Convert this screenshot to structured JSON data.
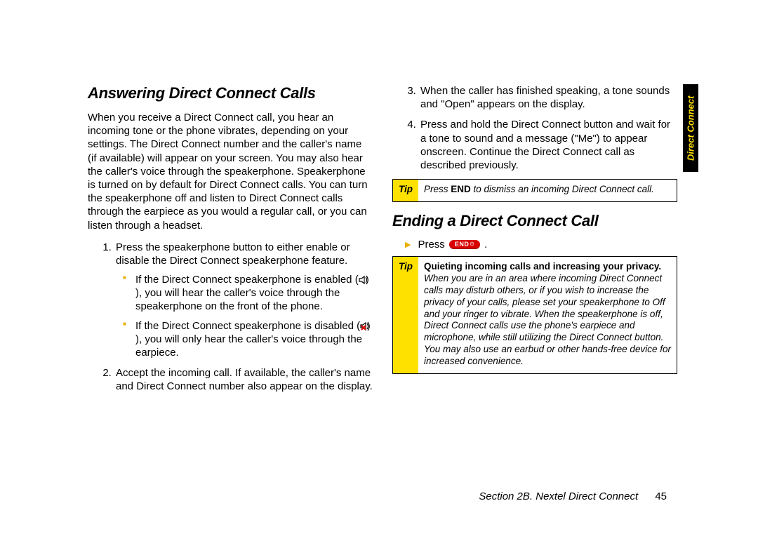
{
  "sideTab": "Direct Connect",
  "left": {
    "h1": "Answering Direct Connect Calls",
    "intro": "When you receive a Direct Connect call, you hear an incoming tone or the phone vibrates, depending on your settings. The Direct Connect number and the caller's name (if available) will appear on your screen. You may also hear the caller's voice through the speakerphone. Speakerphone is turned on by default for Direct Connect calls. You can turn the speakerphone off and listen to Direct Connect calls through the earpiece as you would a regular call, or you can listen through a headset.",
    "steps": {
      "s1": "Press the speakerphone button to either enable or disable the Direct Connect speakerphone feature.",
      "s1a_pre": "If the Direct Connect speakerphone is enabled (",
      "s1a_post": "), you will hear the caller's voice through the speakerphone on the front of the phone.",
      "s1b_pre": "If the Direct Connect speakerphone is disabled (",
      "s1b_post": "), you will only hear the caller's voice through the earpiece.",
      "s2": "Accept the incoming call. If available, the caller's name and Direct Connect number also appear on the display."
    }
  },
  "right": {
    "s3": "When the caller has finished speaking, a tone sounds and \"Open\" appears on the display.",
    "s4": "Press and hold the Direct Connect button and wait for a tone to sound and a message (\"Me\") to appear onscreen. Continue the Direct Connect call as described previously.",
    "tip1": {
      "label": "Tip",
      "pre": "Press ",
      "bold": "END",
      "post": " to dismiss an incoming Direct Connect call."
    },
    "h2": "Ending a Direct Connect Call",
    "pressWord": "Press",
    "endLabel": "END",
    "tip2": {
      "label": "Tip",
      "lead": "Quieting incoming calls and increasing your privacy.",
      "body": "When you are in an area where incoming Direct Connect calls may disturb others, or if you wish to increase the privacy of your calls, please set your speakerphone to Off and your ringer to vibrate. When the speakerphone is off, Direct Connect calls use the phone's earpiece and microphone, while still utilizing the Direct Connect button. You may also use an earbud or other hands-free device for increased convenience."
    }
  },
  "footer": {
    "section": "Section 2B. Nextel Direct Connect",
    "page": "45"
  }
}
